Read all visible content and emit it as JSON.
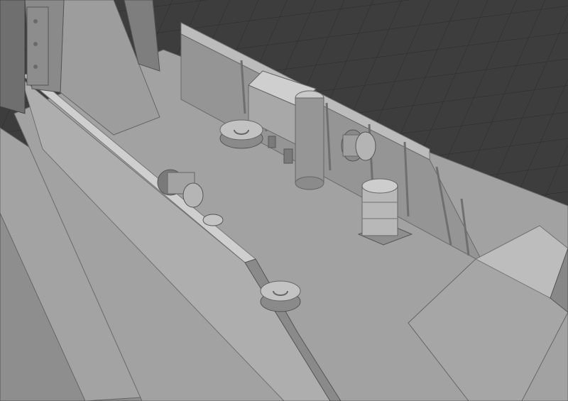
{
  "viewport": {
    "background_color": "#3d3d3d",
    "grid_line_color": "#2a2a2a",
    "model_base_color": "#9a9a9a",
    "model_light_color": "#b4b4b4",
    "model_shadow_color": "#6e6e6e"
  },
  "scene": {
    "objects": [
      {
        "name": "deck-floor"
      },
      {
        "name": "left-bulkhead-wall"
      },
      {
        "name": "rear-bulkhead-wall"
      },
      {
        "name": "boarding-ramp-left"
      },
      {
        "name": "boarding-ramp-right"
      },
      {
        "name": "hatch-door"
      },
      {
        "name": "cargo-crate"
      },
      {
        "name": "vent-cylinder"
      },
      {
        "name": "hatch-cover-rear"
      },
      {
        "name": "hatch-cover-front"
      },
      {
        "name": "winch-drum-rear"
      },
      {
        "name": "winch-drum-front"
      },
      {
        "name": "oil-barrel"
      },
      {
        "name": "hull-side-ramp"
      }
    ]
  }
}
